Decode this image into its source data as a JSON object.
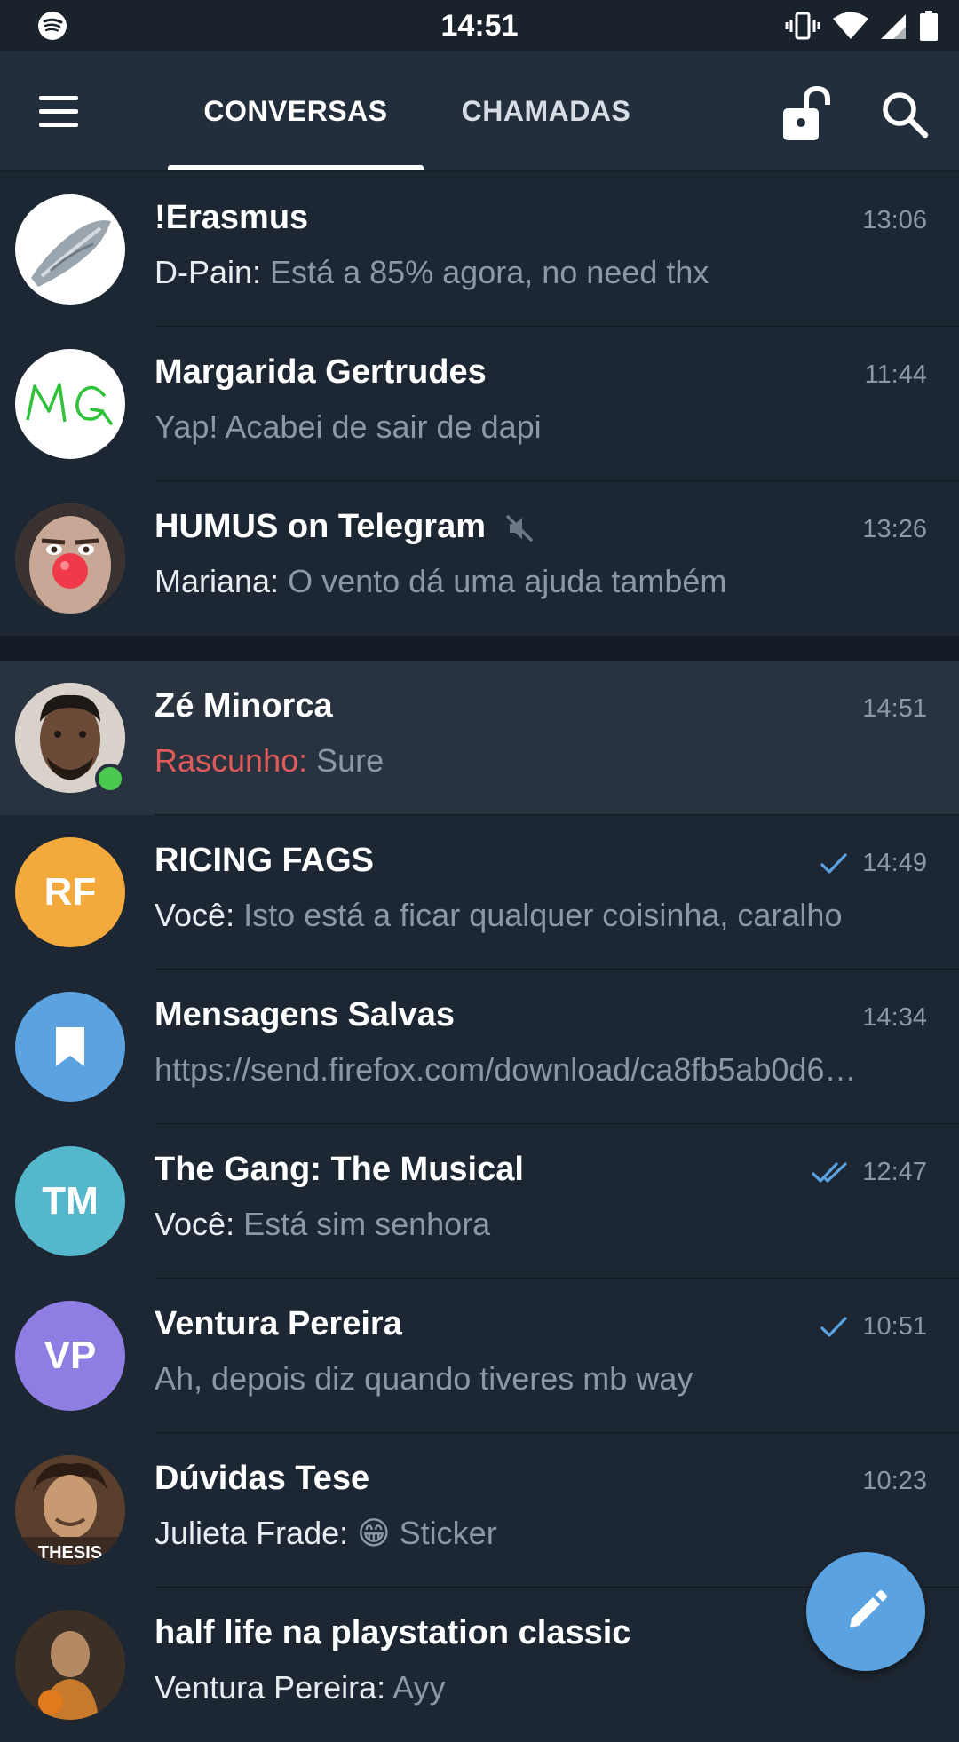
{
  "status_bar": {
    "time": "14:51",
    "icons": [
      "spotify-icon",
      "vibrate-icon",
      "wifi-icon",
      "cell-signal-icon",
      "battery-icon"
    ]
  },
  "header": {
    "tabs": [
      {
        "label": "CONVERSAS",
        "active": true
      },
      {
        "label": "CHAMADAS",
        "active": false
      }
    ],
    "icons": [
      "menu-icon",
      "unlock-icon",
      "search-icon"
    ]
  },
  "chats": [
    {
      "name": "!Erasmus",
      "time": "13:06",
      "sender": "D-Pain: ",
      "preview": "Está a 85% agora, no need thx",
      "avatar": "image"
    },
    {
      "name": "Margarida Gertrudes",
      "time": "11:44",
      "sender": "",
      "preview": "Yap! Acabei de sair de dapi",
      "avatar": "image"
    },
    {
      "name": "HUMUS on Telegram",
      "time": "13:26",
      "sender": "Mariana: ",
      "preview": "O vento dá uma ajuda também",
      "muted": true,
      "avatar": "image"
    },
    {
      "name": "Zé Minorca",
      "time": "14:51",
      "draft_label": "Rascunho: ",
      "preview": "Sure",
      "online": true,
      "avatar": "image"
    },
    {
      "name": "RICING FAGS",
      "time": "14:49",
      "sender": "Você: ",
      "preview": "Isto está a ficar qualquer coisinha, caralho",
      "initials": "RF",
      "color": "#f4a93c",
      "read_state": "sent"
    },
    {
      "name": "Mensagens Salvas",
      "time": "14:34",
      "sender": "",
      "preview": "https://send.firefox.com/download/ca8fb5ab0d6…",
      "color": "#5aa2e0",
      "icon": "bookmark-icon"
    },
    {
      "name": "The Gang: The Musical",
      "time": "12:47",
      "sender": "Você: ",
      "preview": "Está sim senhora",
      "initials": "TM",
      "color": "#55b7cb",
      "read_state": "read"
    },
    {
      "name": "Ventura Pereira",
      "time": "10:51",
      "sender": "",
      "preview": "Ah, depois diz quando tiveres mb way",
      "initials": "VP",
      "color": "#8e7de3",
      "read_state": "sent"
    },
    {
      "name": "Dúvidas Tese",
      "time": "10:23",
      "sender": "Julieta Frade: ",
      "emoji": "😁",
      "preview": "Sticker",
      "avatar_text": "THESIS"
    },
    {
      "name": "half life na playstation classic",
      "time": "",
      "sender": "Ventura Pereira: ",
      "preview": "Ayy",
      "avatar": "image"
    }
  ],
  "fab": {
    "icon": "pencil-icon"
  },
  "colors": {
    "background": "#1d2733",
    "header": "#232e3c",
    "accent": "#5aa2e0",
    "draft": "#e05a5a",
    "online": "#4cc94f"
  }
}
